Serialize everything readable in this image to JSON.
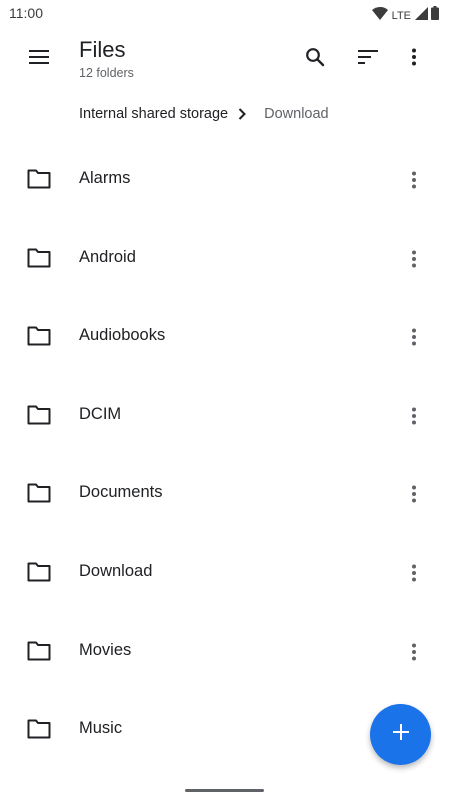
{
  "status_bar": {
    "time": "11:00",
    "network": "LTE",
    "icons": [
      "wifi-icon",
      "cell-signal-icon",
      "battery-icon"
    ]
  },
  "app_bar": {
    "title": "Files",
    "subtitle": "12 folders",
    "icons": [
      "menu-icon",
      "search-icon",
      "sort-icon",
      "more-vert-icon"
    ]
  },
  "breadcrumb": {
    "root": "Internal shared storage",
    "current": "Download"
  },
  "folders": [
    {
      "name": "Alarms"
    },
    {
      "name": "Android"
    },
    {
      "name": "Audiobooks"
    },
    {
      "name": "DCIM"
    },
    {
      "name": "Documents"
    },
    {
      "name": "Download"
    },
    {
      "name": "Movies"
    },
    {
      "name": "Music"
    }
  ],
  "fab": {
    "icon": "add-icon"
  },
  "colors": {
    "accent": "#1a73e8",
    "text_primary": "#202124",
    "text_secondary": "#5f6368"
  }
}
